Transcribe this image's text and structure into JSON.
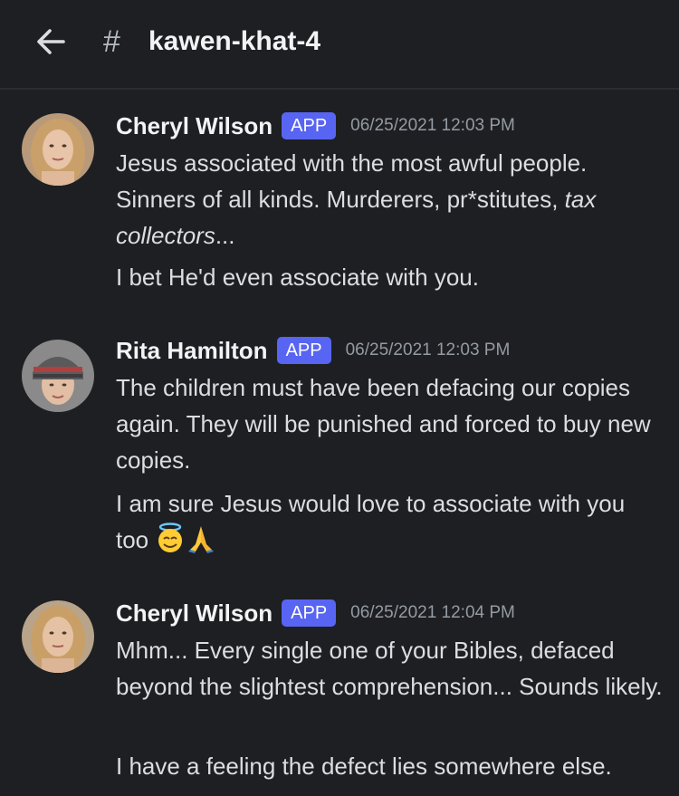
{
  "header": {
    "back_icon": "arrow-left-icon",
    "hash_symbol": "#",
    "channel_name": "kawen-khat-4"
  },
  "messages": [
    {
      "author": "Cheryl Wilson",
      "badge": "APP",
      "timestamp": "06/25/2021 12:03 PM",
      "lines": [
        {
          "plain": "Jesus associated with the most awful people. Sinners of all kinds. Murderers, pr*stitutes, ",
          "italic": "tax collectors",
          "tail": "..."
        },
        {
          "plain": "I bet He'd even associate with you."
        }
      ]
    },
    {
      "author": "Rita Hamilton",
      "badge": "APP",
      "timestamp": "06/25/2021 12:03 PM",
      "lines": [
        {
          "plain": "The children must have been defacing our copies again. They will be punished and forced to buy new copies."
        },
        {
          "plain": "I am sure Jesus would love to associate with you too",
          "emojis": [
            "smiling-face-with-halo-emoji",
            "folded-hands-emoji"
          ]
        }
      ]
    },
    {
      "author": "Cheryl Wilson",
      "badge": "APP",
      "timestamp": "06/25/2021 12:04 PM",
      "lines": [
        {
          "plain": "Mhm... Every single one of your Bibles, defaced beyond the slightest comprehension... Sounds likely."
        },
        {
          "plain": "I have a feeling the defect lies somewhere else."
        }
      ]
    }
  ],
  "colors": {
    "background": "#1e1f22",
    "app_badge": "#5865f2",
    "author": "#f2f3f5",
    "text": "#dbdee1",
    "timestamp": "#949ba4"
  }
}
